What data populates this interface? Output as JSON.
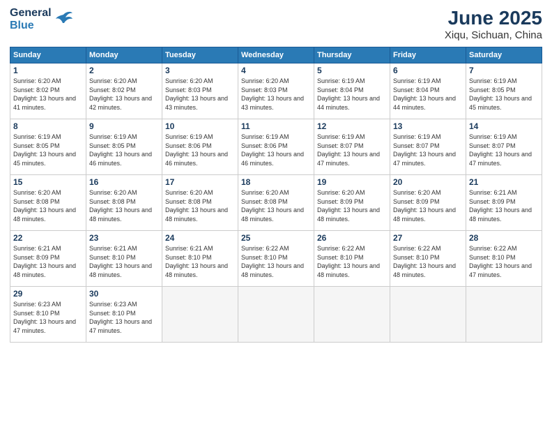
{
  "header": {
    "logo_line1": "General",
    "logo_line2": "Blue",
    "title": "June 2025",
    "subtitle": "Xiqu, Sichuan, China"
  },
  "calendar": {
    "days_of_week": [
      "Sunday",
      "Monday",
      "Tuesday",
      "Wednesday",
      "Thursday",
      "Friday",
      "Saturday"
    ],
    "weeks": [
      [
        null,
        {
          "day": "2",
          "sunrise": "6:20 AM",
          "sunset": "8:02 PM",
          "daylight": "13 hours and 42 minutes."
        },
        {
          "day": "3",
          "sunrise": "6:20 AM",
          "sunset": "8:03 PM",
          "daylight": "13 hours and 43 minutes."
        },
        {
          "day": "4",
          "sunrise": "6:20 AM",
          "sunset": "8:03 PM",
          "daylight": "13 hours and 43 minutes."
        },
        {
          "day": "5",
          "sunrise": "6:19 AM",
          "sunset": "8:04 PM",
          "daylight": "13 hours and 44 minutes."
        },
        {
          "day": "6",
          "sunrise": "6:19 AM",
          "sunset": "8:04 PM",
          "daylight": "13 hours and 44 minutes."
        },
        {
          "day": "7",
          "sunrise": "6:19 AM",
          "sunset": "8:05 PM",
          "daylight": "13 hours and 45 minutes."
        }
      ],
      [
        {
          "day": "1",
          "sunrise": "6:20 AM",
          "sunset": "8:02 PM",
          "daylight": "13 hours and 41 minutes."
        },
        {
          "day": "9",
          "sunrise": "6:19 AM",
          "sunset": "8:05 PM",
          "daylight": "13 hours and 46 minutes."
        },
        {
          "day": "10",
          "sunrise": "6:19 AM",
          "sunset": "8:06 PM",
          "daylight": "13 hours and 46 minutes."
        },
        {
          "day": "11",
          "sunrise": "6:19 AM",
          "sunset": "8:06 PM",
          "daylight": "13 hours and 46 minutes."
        },
        {
          "day": "12",
          "sunrise": "6:19 AM",
          "sunset": "8:07 PM",
          "daylight": "13 hours and 47 minutes."
        },
        {
          "day": "13",
          "sunrise": "6:19 AM",
          "sunset": "8:07 PM",
          "daylight": "13 hours and 47 minutes."
        },
        {
          "day": "14",
          "sunrise": "6:19 AM",
          "sunset": "8:07 PM",
          "daylight": "13 hours and 47 minutes."
        }
      ],
      [
        {
          "day": "8",
          "sunrise": "6:19 AM",
          "sunset": "8:05 PM",
          "daylight": "13 hours and 45 minutes."
        },
        {
          "day": "16",
          "sunrise": "6:20 AM",
          "sunset": "8:08 PM",
          "daylight": "13 hours and 48 minutes."
        },
        {
          "day": "17",
          "sunrise": "6:20 AM",
          "sunset": "8:08 PM",
          "daylight": "13 hours and 48 minutes."
        },
        {
          "day": "18",
          "sunrise": "6:20 AM",
          "sunset": "8:08 PM",
          "daylight": "13 hours and 48 minutes."
        },
        {
          "day": "19",
          "sunrise": "6:20 AM",
          "sunset": "8:09 PM",
          "daylight": "13 hours and 48 minutes."
        },
        {
          "day": "20",
          "sunrise": "6:20 AM",
          "sunset": "8:09 PM",
          "daylight": "13 hours and 48 minutes."
        },
        {
          "day": "21",
          "sunrise": "6:21 AM",
          "sunset": "8:09 PM",
          "daylight": "13 hours and 48 minutes."
        }
      ],
      [
        {
          "day": "15",
          "sunrise": "6:20 AM",
          "sunset": "8:08 PM",
          "daylight": "13 hours and 48 minutes."
        },
        {
          "day": "23",
          "sunrise": "6:21 AM",
          "sunset": "8:10 PM",
          "daylight": "13 hours and 48 minutes."
        },
        {
          "day": "24",
          "sunrise": "6:21 AM",
          "sunset": "8:10 PM",
          "daylight": "13 hours and 48 minutes."
        },
        {
          "day": "25",
          "sunrise": "6:22 AM",
          "sunset": "8:10 PM",
          "daylight": "13 hours and 48 minutes."
        },
        {
          "day": "26",
          "sunrise": "6:22 AM",
          "sunset": "8:10 PM",
          "daylight": "13 hours and 48 minutes."
        },
        {
          "day": "27",
          "sunrise": "6:22 AM",
          "sunset": "8:10 PM",
          "daylight": "13 hours and 48 minutes."
        },
        {
          "day": "28",
          "sunrise": "6:22 AM",
          "sunset": "8:10 PM",
          "daylight": "13 hours and 47 minutes."
        }
      ],
      [
        {
          "day": "22",
          "sunrise": "6:21 AM",
          "sunset": "8:09 PM",
          "daylight": "13 hours and 48 minutes."
        },
        {
          "day": "30",
          "sunrise": "6:23 AM",
          "sunset": "8:10 PM",
          "daylight": "13 hours and 47 minutes."
        },
        null,
        null,
        null,
        null,
        null
      ],
      [
        {
          "day": "29",
          "sunrise": "6:23 AM",
          "sunset": "8:10 PM",
          "daylight": "13 hours and 47 minutes."
        },
        null,
        null,
        null,
        null,
        null,
        null
      ]
    ]
  }
}
